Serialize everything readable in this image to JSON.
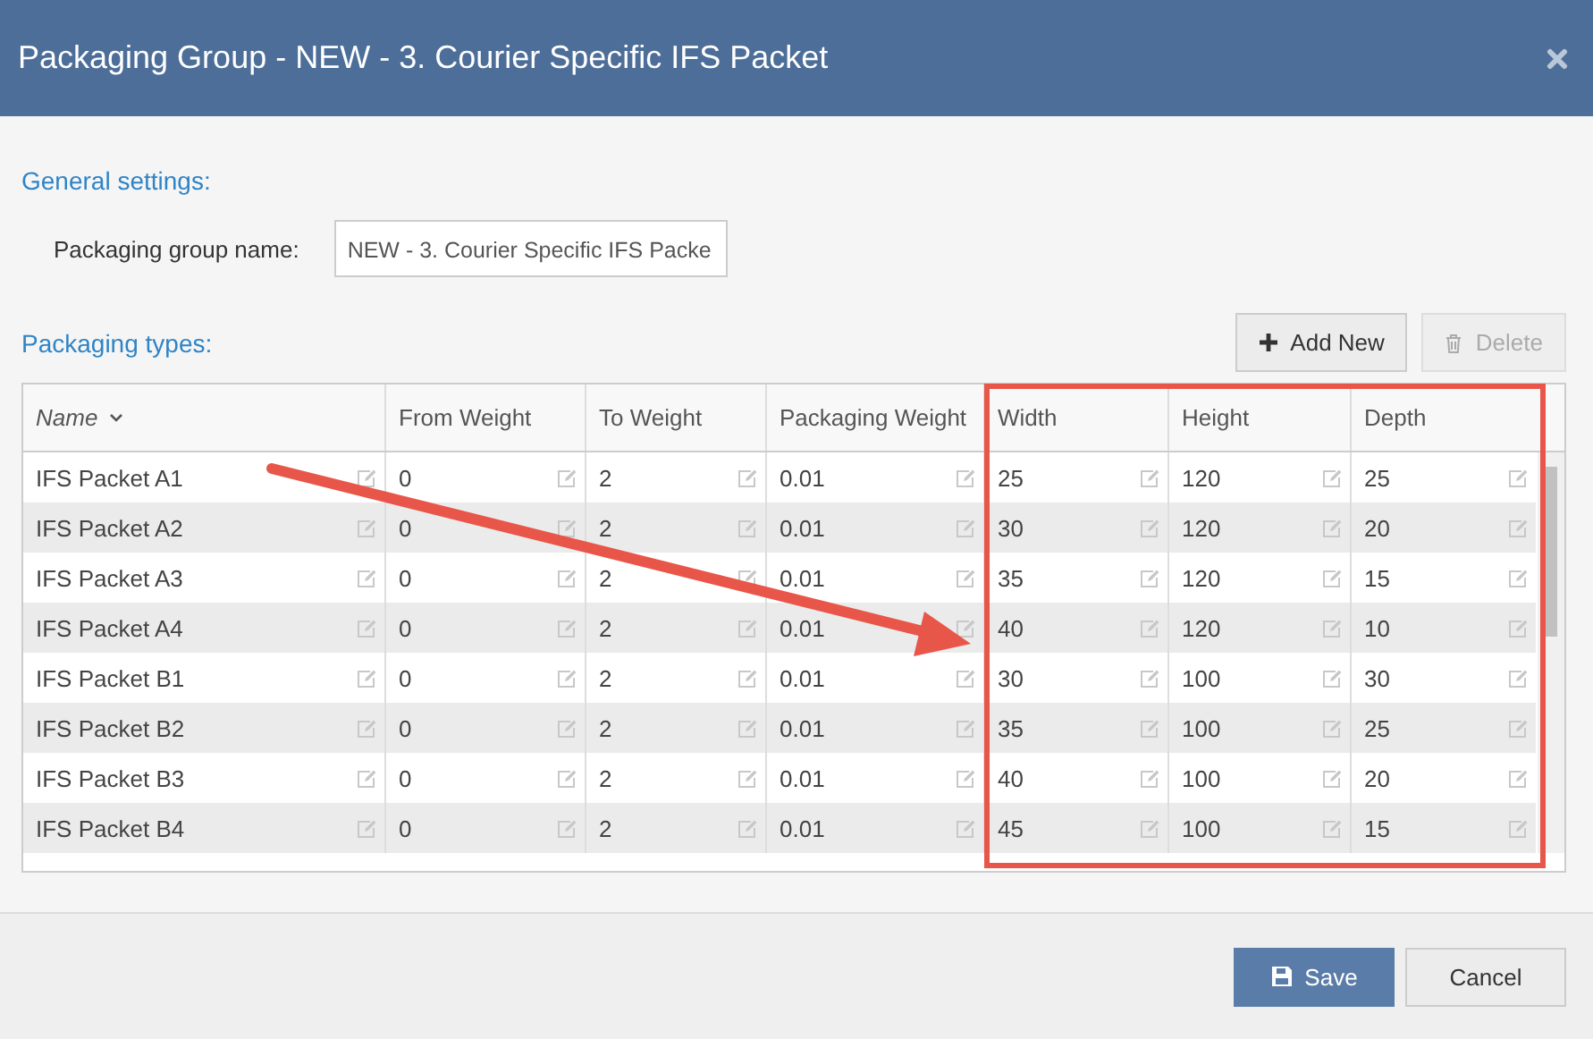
{
  "window": {
    "title": "Packaging Group - NEW - 3. Courier Specific IFS Packet"
  },
  "general_settings": {
    "heading": "General settings:",
    "field_label": "Packaging group name:",
    "field_value": "NEW - 3. Courier Specific IFS Packe"
  },
  "packaging_types": {
    "heading": "Packaging types:",
    "toolbar": [
      {
        "kind": "add",
        "label": "Add New",
        "disabled": false
      },
      {
        "kind": "delete",
        "label": "Delete",
        "disabled": true
      }
    ],
    "table": {
      "columns": [
        {
          "label": "Name",
          "sorted": true
        },
        {
          "label": "From Weight",
          "sorted": false
        },
        {
          "label": "To Weight",
          "sorted": false
        },
        {
          "label": "Packaging Weight",
          "sorted": false
        },
        {
          "label": "Width",
          "sorted": false
        },
        {
          "label": "Height",
          "sorted": false
        },
        {
          "label": "Depth",
          "sorted": false
        }
      ],
      "rows": [
        {
          "cells": [
            "IFS Packet A1",
            "0",
            "2",
            "0.01",
            "25",
            "120",
            "25"
          ]
        },
        {
          "cells": [
            "IFS Packet A2",
            "0",
            "2",
            "0.01",
            "30",
            "120",
            "20"
          ]
        },
        {
          "cells": [
            "IFS Packet A3",
            "0",
            "2",
            "0.01",
            "35",
            "120",
            "15"
          ]
        },
        {
          "cells": [
            "IFS Packet A4",
            "0",
            "2",
            "0.01",
            "40",
            "120",
            "10"
          ]
        },
        {
          "cells": [
            "IFS Packet B1",
            "0",
            "2",
            "0.01",
            "30",
            "100",
            "30"
          ]
        },
        {
          "cells": [
            "IFS Packet B2",
            "0",
            "2",
            "0.01",
            "35",
            "100",
            "25"
          ]
        },
        {
          "cells": [
            "IFS Packet B3",
            "0",
            "2",
            "0.01",
            "40",
            "100",
            "20"
          ]
        },
        {
          "cells": [
            "IFS Packet B4",
            "0",
            "2",
            "0.01",
            "45",
            "100",
            "15"
          ]
        }
      ]
    }
  },
  "footer": {
    "buttons": [
      {
        "kind": "primary",
        "label": "Save"
      },
      {
        "kind": "secondary",
        "label": "Cancel"
      }
    ]
  }
}
